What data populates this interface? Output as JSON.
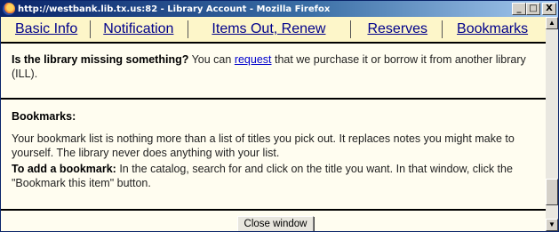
{
  "window": {
    "title": "http://westbank.lib.tx.us:82 - Library Account - Mozilla Firefox",
    "minimize": "_",
    "maximize": "□",
    "close": "X"
  },
  "nav": {
    "items": [
      "Basic Info",
      "Notification",
      "Items Out, Renew",
      "Reserves",
      "Bookmarks"
    ]
  },
  "missing": {
    "heading": "Is the library missing something?",
    "text_before": " You can ",
    "link": "request",
    "text_after": " that we purchase it or borrow it from another library (ILL)."
  },
  "bookmarks": {
    "heading": "Bookmarks:",
    "description": "Your bookmark list is nothing more than a list of titles you pick out. It replaces notes you might make to yourself. The library never does anything with your list.",
    "add_heading": "To add a bookmark:",
    "add_text": " In the catalog, search for and click on the title you want. In that window, click the \"Bookmark this item\" button."
  },
  "close_button": "Close window",
  "scrollbar": {
    "up_arrow": "▲",
    "down_arrow": "▼",
    "thumb_position": 0.92
  },
  "colors": {
    "nav_link": "#00008b",
    "link": "#0000cc",
    "content_bg": "#fffdf0",
    "nav_bg": "#fdf6c9"
  }
}
